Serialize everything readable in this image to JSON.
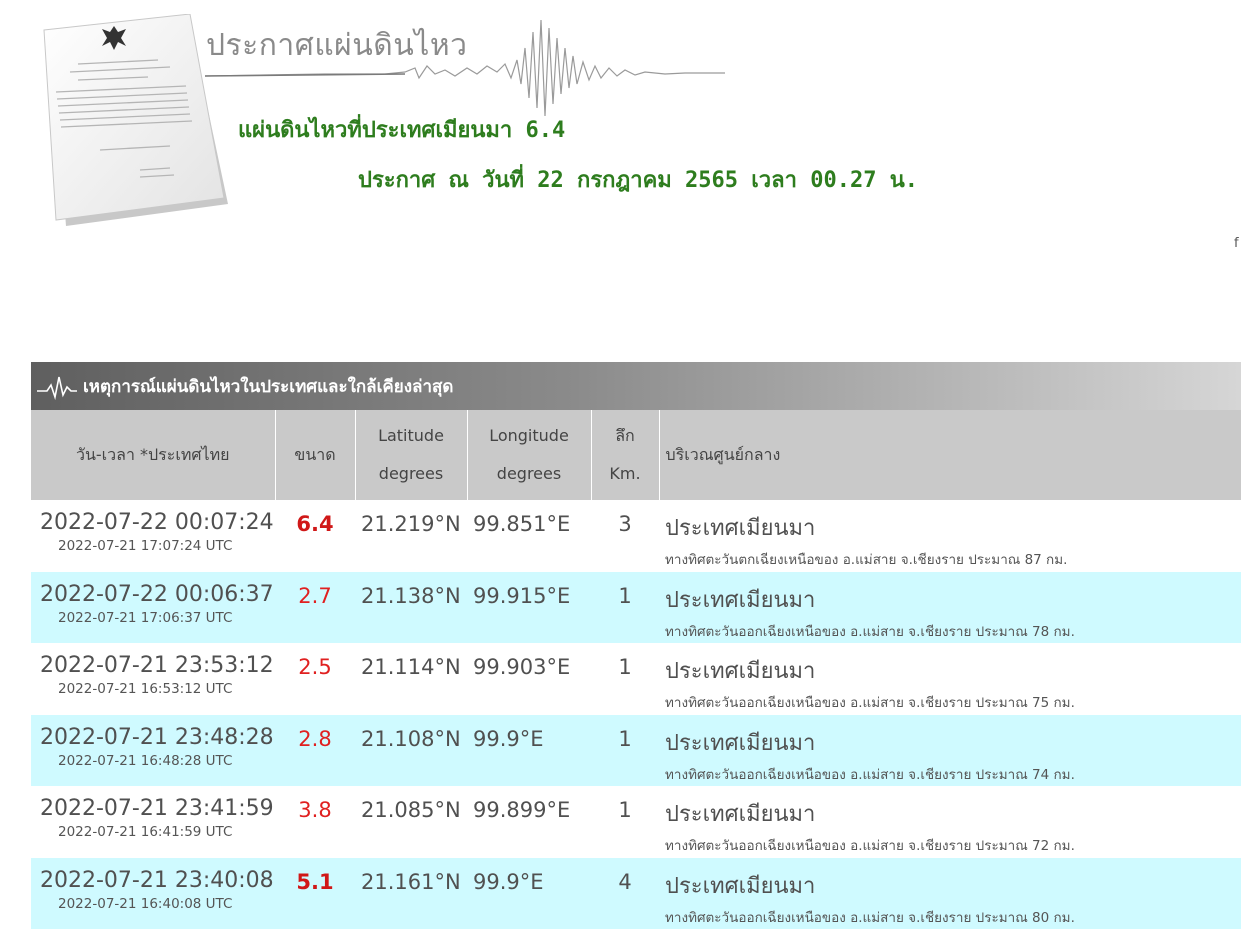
{
  "header": {
    "title": "ประกาศแผ่นดินไหว",
    "quake_title": "แผ่นดินไหวที่ประเทศเมียนมา 6.4",
    "announce": "ประกาศ ณ วันที่ 22 กรกฎาคม 2565 เวลา 00.27 น.",
    "edge_char": "f"
  },
  "panel": {
    "title": "เหตุการณ์แผ่นดินไหวในประเทศและใกล้เคียงล่าสุด",
    "columns": {
      "datetime": "วัน-เวลา *ประเทศไทย",
      "magnitude": "ขนาด",
      "lat_top": "Latitude",
      "lat_bottom": "degrees",
      "lon_top": "Longitude",
      "lon_bottom": "degrees",
      "depth_top": "ลึก",
      "depth_bottom": "Km.",
      "epicenter": "บริเวณศูนย์กลาง"
    },
    "rows": [
      {
        "local": "2022-07-22 00:07:24",
        "utc": "2022-07-21 17:07:24 UTC",
        "mag": "6.4",
        "lat": "21.219°N",
        "lon": "99.851°E",
        "depth": "3",
        "place": "ประเทศเมียนมา",
        "desc": "ทางทิศตะวันตกเฉียงเหนือของ อ.แม่สาย จ.เชียงราย ประมาณ 87 กม."
      },
      {
        "local": "2022-07-22 00:06:37",
        "utc": "2022-07-21 17:06:37 UTC",
        "mag": "2.7",
        "lat": "21.138°N",
        "lon": "99.915°E",
        "depth": "1",
        "place": "ประเทศเมียนมา",
        "desc": "ทางทิศตะวันออกเฉียงเหนือของ อ.แม่สาย จ.เชียงราย ประมาณ 78 กม."
      },
      {
        "local": "2022-07-21 23:53:12",
        "utc": "2022-07-21 16:53:12 UTC",
        "mag": "2.5",
        "lat": "21.114°N",
        "lon": "99.903°E",
        "depth": "1",
        "place": "ประเทศเมียนมา",
        "desc": "ทางทิศตะวันออกเฉียงเหนือของ อ.แม่สาย จ.เชียงราย ประมาณ 75 กม."
      },
      {
        "local": "2022-07-21 23:48:28",
        "utc": "2022-07-21 16:48:28 UTC",
        "mag": "2.8",
        "lat": "21.108°N",
        "lon": "99.9°E",
        "depth": "1",
        "place": "ประเทศเมียนมา",
        "desc": "ทางทิศตะวันออกเฉียงเหนือของ อ.แม่สาย จ.เชียงราย ประมาณ 74 กม."
      },
      {
        "local": "2022-07-21 23:41:59",
        "utc": "2022-07-21 16:41:59 UTC",
        "mag": "3.8",
        "lat": "21.085°N",
        "lon": "99.899°E",
        "depth": "1",
        "place": "ประเทศเมียนมา",
        "desc": "ทางทิศตะวันออกเฉียงเหนือของ อ.แม่สาย จ.เชียงราย ประมาณ 72 กม."
      },
      {
        "local": "2022-07-21 23:40:08",
        "utc": "2022-07-21 16:40:08 UTC",
        "mag": "5.1",
        "lat": "21.161°N",
        "lon": "99.9°E",
        "depth": "4",
        "place": "ประเทศเมียนมา",
        "desc": "ทางทิศตะวันออกเฉียงเหนือของ อ.แม่สาย จ.เชียงราย ประมาณ 80 กม."
      }
    ]
  },
  "colors": {
    "accent_green": "#2e7d1e",
    "magnitude_red": "#d01818",
    "row_alt": "#cffaff",
    "table_header": "#c9c9c9"
  }
}
